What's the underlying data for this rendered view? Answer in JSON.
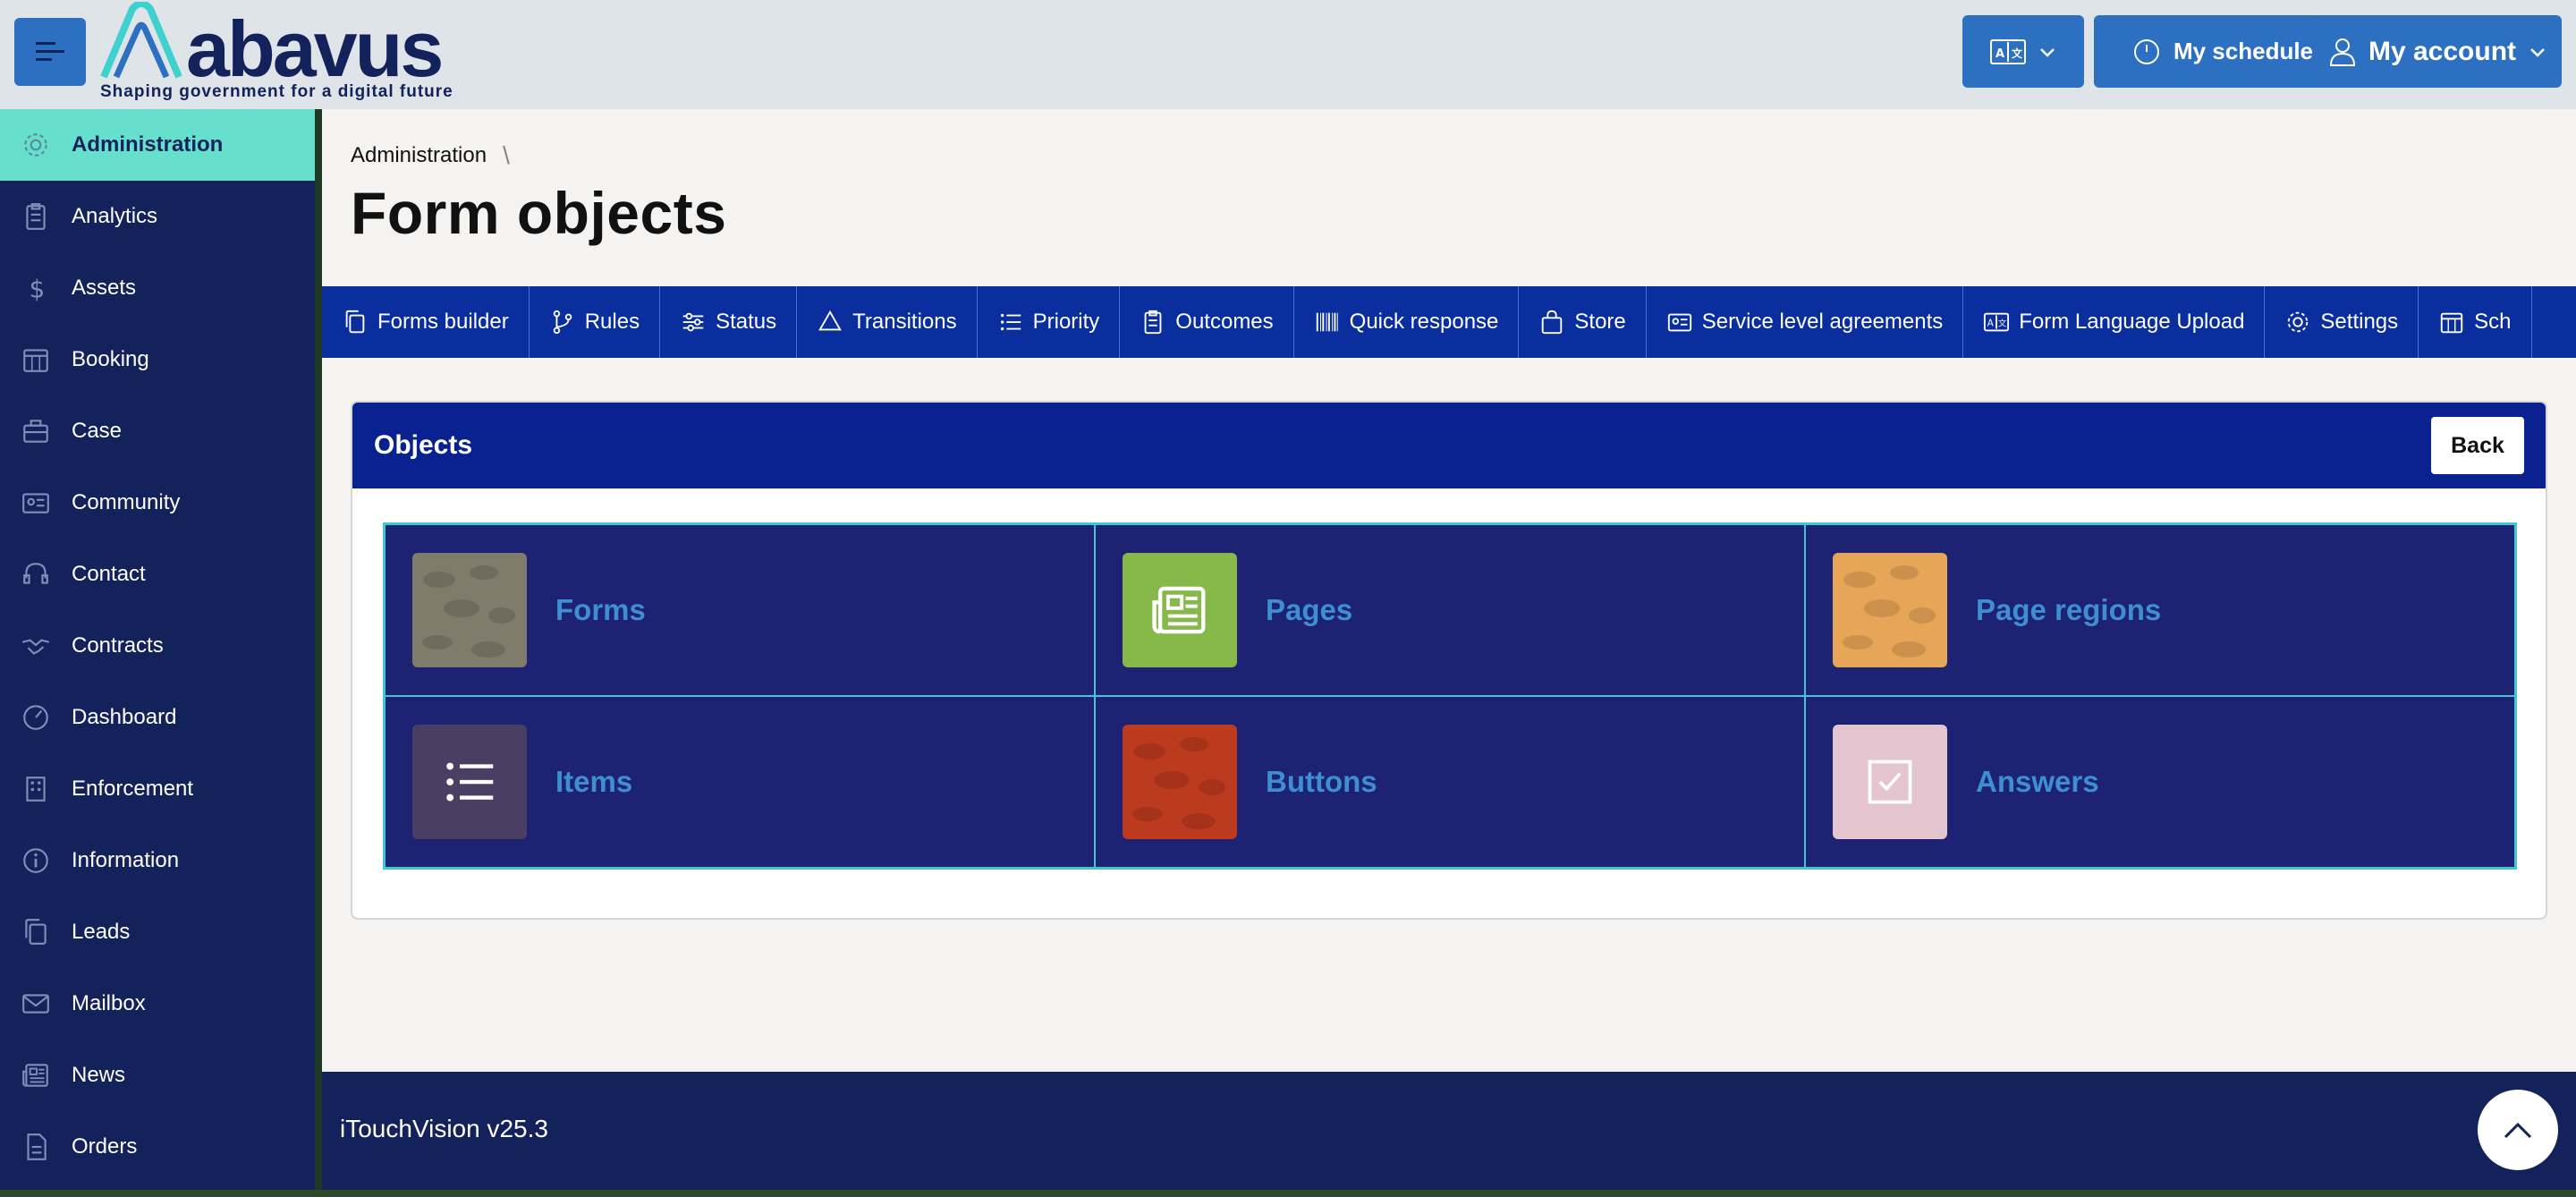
{
  "header": {
    "logo_text": "abavus",
    "logo_tagline": "Shaping government for a digital future",
    "schedule_label": "My schedule",
    "account_label": "My account"
  },
  "sidebar": {
    "items": [
      {
        "label": "Administration",
        "icon": "gear-icon",
        "active": true
      },
      {
        "label": "Analytics",
        "icon": "clipboard-icon"
      },
      {
        "label": "Assets",
        "icon": "dollar-icon"
      },
      {
        "label": "Booking",
        "icon": "calendar-icon"
      },
      {
        "label": "Case",
        "icon": "briefcase-icon"
      },
      {
        "label": "Community",
        "icon": "id-card-icon"
      },
      {
        "label": "Contact",
        "icon": "headset-icon"
      },
      {
        "label": "Contracts",
        "icon": "handshake-icon"
      },
      {
        "label": "Dashboard",
        "icon": "gauge-icon"
      },
      {
        "label": "Enforcement",
        "icon": "building-icon"
      },
      {
        "label": "Information",
        "icon": "info-icon"
      },
      {
        "label": "Leads",
        "icon": "copy-icon"
      },
      {
        "label": "Mailbox",
        "icon": "envelope-icon"
      },
      {
        "label": "News",
        "icon": "newspaper-icon"
      },
      {
        "label": "Orders",
        "icon": "document-icon"
      }
    ]
  },
  "breadcrumb": {
    "item": "Administration",
    "separator": "\\"
  },
  "page_title": "Form objects",
  "tabs": [
    {
      "label": "Forms builder",
      "icon": "copy-icon"
    },
    {
      "label": "Rules",
      "icon": "branch-icon"
    },
    {
      "label": "Status",
      "icon": "sliders-icon"
    },
    {
      "label": "Transitions",
      "icon": "recycle-icon"
    },
    {
      "label": "Priority",
      "icon": "list-icon"
    },
    {
      "label": "Outcomes",
      "icon": "clipboard-icon"
    },
    {
      "label": "Quick response",
      "icon": "barcode-icon"
    },
    {
      "label": "Store",
      "icon": "bag-icon"
    },
    {
      "label": "Service level agreements",
      "icon": "id-card-icon"
    },
    {
      "label": "Form Language Upload",
      "icon": "translate-icon"
    },
    {
      "label": "Settings",
      "icon": "gear-icon"
    },
    {
      "label": "Sch",
      "icon": "calendar-icon"
    }
  ],
  "panel": {
    "title": "Objects",
    "back_label": "Back",
    "tiles": [
      {
        "label": "Forms",
        "color": "#807b6a",
        "icon": "texture-icon"
      },
      {
        "label": "Pages",
        "color": "#86b84a",
        "icon": "newspaper-icon"
      },
      {
        "label": "Page regions",
        "color": "#e7a558",
        "icon": "texture-icon"
      },
      {
        "label": "Items",
        "color": "#4a3f63",
        "icon": "list-icon"
      },
      {
        "label": "Buttons",
        "color": "#bc3a1e",
        "icon": "texture-icon"
      },
      {
        "label": "Answers",
        "color": "#e4c5cf",
        "icon": "checkbox-icon"
      }
    ]
  },
  "footer": {
    "version": "iTouchVision v25.3"
  },
  "colors": {
    "brand_navy": "#14225c",
    "accent_teal": "#66e0cc",
    "tab_blue": "#0a2e9e",
    "button_blue": "#2d6fc0"
  }
}
